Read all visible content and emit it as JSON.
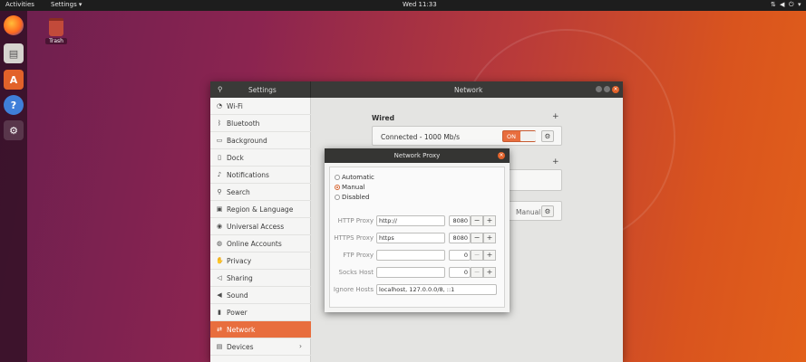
{
  "topbar": {
    "activities": "Activities",
    "app_menu": "Settings ▾",
    "clock": "Wed 11:33",
    "tray_icons": [
      "network-icon",
      "volume-icon",
      "power-icon",
      "chevron-down-icon"
    ]
  },
  "desktop": {
    "trash_label": "Trash"
  },
  "window": {
    "sidebar_title": "Settings",
    "title": "Network",
    "sidebar_items": [
      {
        "label": "Wi-Fi",
        "icon": "wifi-icon"
      },
      {
        "label": "Bluetooth",
        "icon": "bluetooth-icon"
      },
      {
        "label": "Background",
        "icon": "background-icon"
      },
      {
        "label": "Dock",
        "icon": "dock-icon"
      },
      {
        "label": "Notifications",
        "icon": "bell-icon"
      },
      {
        "label": "Search",
        "icon": "search-icon"
      },
      {
        "label": "Region & Language",
        "icon": "camera-icon"
      },
      {
        "label": "Universal Access",
        "icon": "accessibility-icon"
      },
      {
        "label": "Online Accounts",
        "icon": "accounts-icon"
      },
      {
        "label": "Privacy",
        "icon": "hand-icon"
      },
      {
        "label": "Sharing",
        "icon": "share-icon"
      },
      {
        "label": "Sound",
        "icon": "speaker-icon"
      },
      {
        "label": "Power",
        "icon": "power-icon"
      },
      {
        "label": "Network",
        "icon": "network-icon"
      },
      {
        "label": "Devices",
        "icon": "devices-icon"
      }
    ],
    "wired": {
      "title": "Wired",
      "status": "Connected - 1000 Mb/s",
      "toggle": "ON"
    },
    "proxy_row_value": "Manual"
  },
  "dialog": {
    "title": "Network Proxy",
    "modes": [
      "Automatic",
      "Manual",
      "Disabled"
    ],
    "selected_mode": "Manual",
    "rows": [
      {
        "label": "HTTP Proxy",
        "host": "http://",
        "port": "8080"
      },
      {
        "label": "HTTPS Proxy",
        "host": "https",
        "port": "8080"
      },
      {
        "label": "FTP Proxy",
        "host": "",
        "port": "0"
      },
      {
        "label": "Socks Host",
        "host": "",
        "port": "0"
      }
    ],
    "ignore_label": "Ignore Hosts",
    "ignore_value": "localhost, 127.0.0.0/8, ::1"
  },
  "colors": {
    "accent": "#e86e3e",
    "titlebar": "#3a3a38"
  }
}
